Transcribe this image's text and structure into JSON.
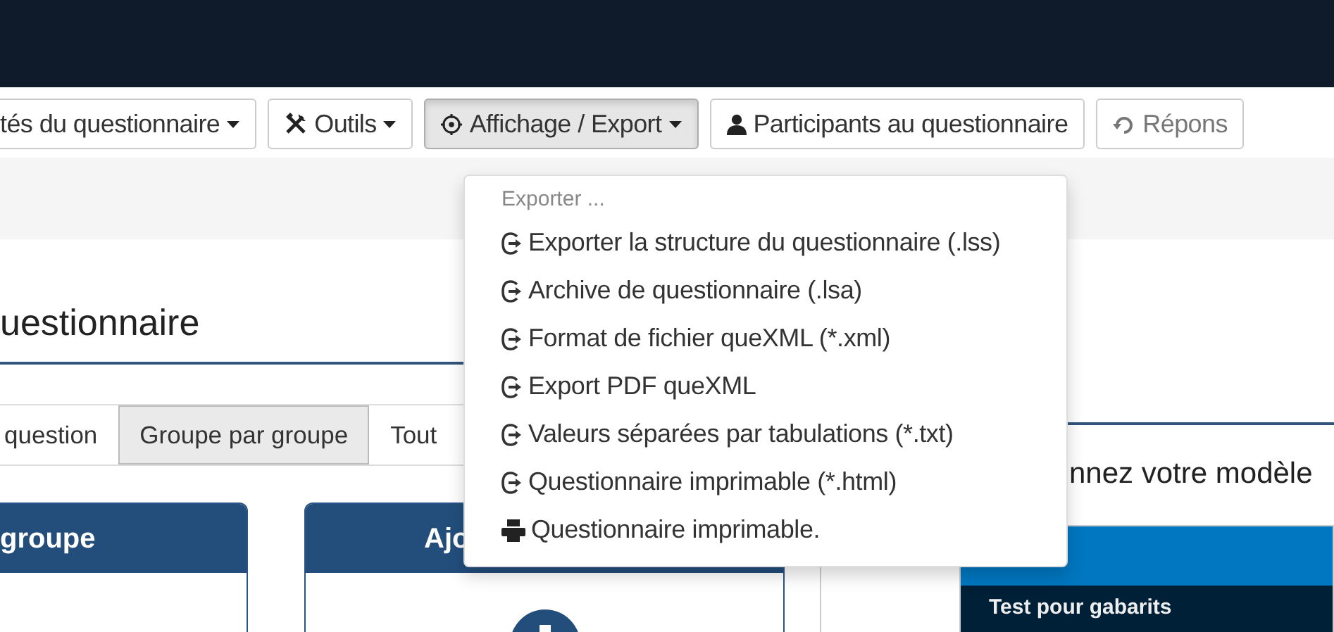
{
  "toolbar": [
    {
      "label": "tés du questionnaire",
      "caret": true,
      "active": false
    },
    {
      "label": "Outils",
      "caret": true,
      "active": false
    },
    {
      "label": "Affichage / Export",
      "caret": true,
      "active": true
    },
    {
      "label": "Participants au questionnaire",
      "caret": false,
      "active": false
    },
    {
      "label": "Répons",
      "caret": false,
      "active": false
    }
  ],
  "dropdown": {
    "header": "Exporter ...",
    "items": [
      {
        "label": "Exporter la structure du questionnaire (.lss)",
        "kind": "file"
      },
      {
        "label": "Archive de questionnaire (.lsa)",
        "kind": "file"
      },
      {
        "label": "Format de fichier queXML (*.xml)",
        "kind": "file"
      },
      {
        "label": "Export PDF queXML",
        "kind": "file"
      },
      {
        "label": "Valeurs séparées par tabulations (*.txt)",
        "kind": "file"
      },
      {
        "label": "Questionnaire imprimable (*.html)",
        "kind": "file"
      },
      {
        "label": "Questionnaire imprimable.",
        "kind": "print"
      }
    ]
  },
  "page_title": "uestionnaire",
  "tabs": [
    {
      "label": "question",
      "selected": false
    },
    {
      "label": "Groupe par groupe",
      "selected": true
    },
    {
      "label": "Tout",
      "selected": false
    }
  ],
  "cards": [
    {
      "title": "groupe",
      "plus": false
    },
    {
      "title": "Ajo",
      "plus": true
    }
  ],
  "template_heading": "nnez votre modèle",
  "template_card": {
    "name": "Test pour gabarits"
  }
}
